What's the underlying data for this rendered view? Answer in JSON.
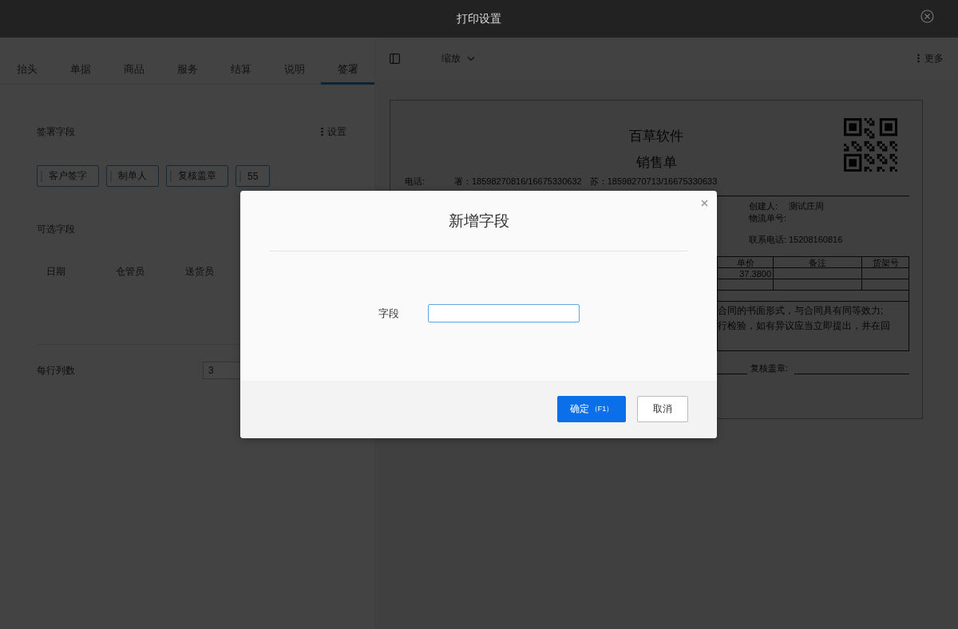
{
  "window": {
    "title": "打印设置"
  },
  "settings_panel": {
    "tabs": [
      {
        "label": "抬头",
        "selected": false
      },
      {
        "label": "单据",
        "selected": false
      },
      {
        "label": "商品",
        "selected": false
      },
      {
        "label": "服务",
        "selected": false
      },
      {
        "label": "结算",
        "selected": false
      },
      {
        "label": "说明",
        "selected": false
      },
      {
        "label": "签署",
        "selected": true
      }
    ],
    "signature_fields": {
      "title": "签署字段",
      "action": "设置",
      "tags": [
        "客户签字",
        "制单人",
        "复核盖章",
        "55"
      ]
    },
    "optional_fields": {
      "title": "可选字段",
      "items": [
        "日期",
        "仓管员",
        "送货员"
      ]
    },
    "columns_per_row": {
      "label": "每行列数",
      "value": "3"
    }
  },
  "preview": {
    "toolbar": {
      "zoom": "缩放",
      "more": "更多"
    },
    "document": {
      "company": "百草软件",
      "title": "销售单",
      "contact_line": [
        "电话:",
        "署：18598270816/16675330632",
        "苏：18598270713/16675330633"
      ],
      "info": [
        {
          "label": "创建人:",
          "value": "测试庄周"
        },
        {
          "label": "物流单号:"
        },
        {
          "label": "联系电话:",
          "value": "15208160816"
        }
      ],
      "table": {
        "columns": [
          "单价",
          "备注",
          "货架号"
        ],
        "rows": [
          [
            "37.3800"
          ]
        ]
      },
      "notes": [
        "合同的书面形式，与合同具有同等效力;",
        "行检验，如有异议应当立即提出，并在回"
      ],
      "signature": "复核盖章:"
    }
  },
  "dialog": {
    "title": "新增字段",
    "field_label": "字段",
    "buttons": [
      {
        "label": "确定",
        "shortcut": "（F1）",
        "kind": "primary"
      },
      {
        "label": "取消",
        "kind": "secondary"
      }
    ]
  }
}
